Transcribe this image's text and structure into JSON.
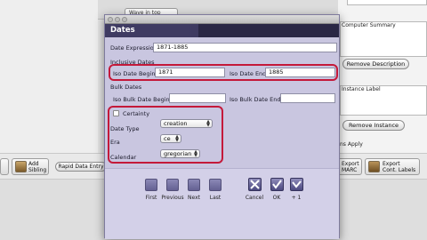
{
  "background": {
    "top_select": "Wave in top",
    "component_summary_label": "Computer Summary",
    "remove_description_label": "Remove Description",
    "instance_label_header": "Instance Label",
    "remove_instance_label": "Remove Instance",
    "apply_text": "ns Apply",
    "add_sibling_label": "Add\nSibling",
    "rapid_data_entry_label": "Rapid Data Entry",
    "export_marc_label": "Export\nMARC",
    "export_cont_labels_label": "Export\nCont. Labels"
  },
  "dialog": {
    "title": "Dates",
    "date_expression_label": "Date Expression",
    "date_expression_value": "1871-1885",
    "inclusive_dates_heading": "Inclusive Dates",
    "iso_date_begin_label": "Iso Date Begin",
    "iso_date_begin_value": "1871",
    "iso_date_end_label": "Iso Date End",
    "iso_date_end_value": "1885",
    "bulk_dates_heading": "Bulk Dates",
    "iso_bulk_date_begin_label": "Iso Bulk Date Begin",
    "iso_bulk_date_begin_value": "",
    "iso_bulk_date_end_label": "Iso Bulk Date End",
    "iso_bulk_date_end_value": "",
    "certainty_label": "Certainty",
    "date_type_label": "Date Type",
    "date_type_value": "creation",
    "era_label": "Era",
    "era_value": "ce",
    "calendar_label": "Calendar",
    "calendar_value": "gregorian",
    "nav": {
      "first_label": "First",
      "previous_label": "Previous",
      "next_label": "Next",
      "last_label": "Last",
      "cancel_label": "Cancel",
      "ok_label": "OK",
      "plus_one_label": "+ 1"
    }
  },
  "colors": {
    "dialog_bg": "#c9c6e0",
    "header_bg": "#3f3b62",
    "highlight": "#c4193a"
  }
}
